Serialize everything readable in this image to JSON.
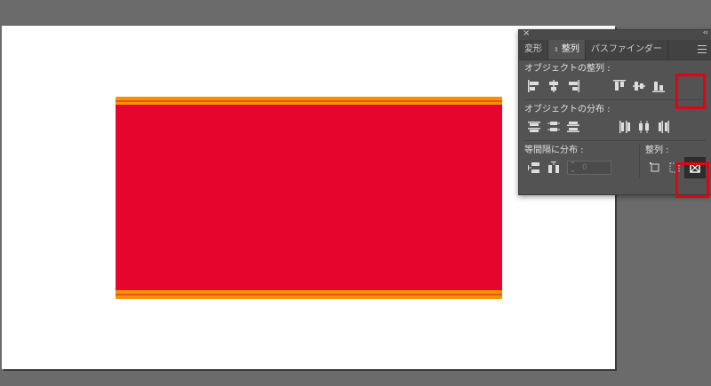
{
  "panel": {
    "close_icon": "×",
    "collapse_icon": "‹‹",
    "tabs": [
      {
        "label": "変形"
      },
      {
        "label": "整列",
        "active": true
      },
      {
        "label": "パスファインダー"
      }
    ],
    "sections": {
      "align_objects": "オブジェクトの整列 :",
      "distribute_objects": "オブジェクトの分布 :",
      "distribute_spacing": "等間隔に分布 :",
      "align_to": "整列 :"
    },
    "spacing_value": "0"
  },
  "colors": {
    "canvas_bg": "#6b6b6b",
    "artboard": "#ffffff",
    "orange_band": "#f29400",
    "red_fill": "#e6062d",
    "highlight": "#e60012"
  }
}
